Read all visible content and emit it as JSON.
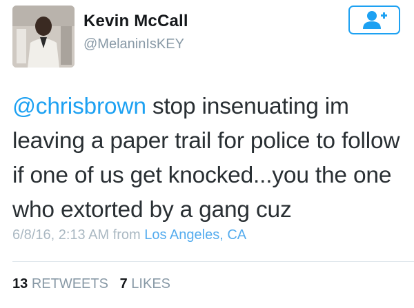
{
  "user": {
    "name": "Kevin McCall",
    "handle": "@MelaninIsKEY"
  },
  "follow_button": {
    "icon": "follow-user-plus-icon",
    "color": "#1da1f2"
  },
  "tweet": {
    "mention": "@chrisbrown",
    "text_rest": " stop insenuating im leaving a paper trail for police to follow if one of us get knocked...you the one who extorted by a gang cuz"
  },
  "meta": {
    "timestamp": "6/8/16, 2:13 AM",
    "from_label": "from",
    "location": "Los Angeles, CA"
  },
  "stats": {
    "retweets_count": "13",
    "retweets_label": "RETWEETS",
    "likes_count": "7",
    "likes_label": "LIKES"
  },
  "colors": {
    "accent": "#1da1f2",
    "text": "#292f33",
    "muted": "#8899a6",
    "divider": "#e1e8ed"
  }
}
